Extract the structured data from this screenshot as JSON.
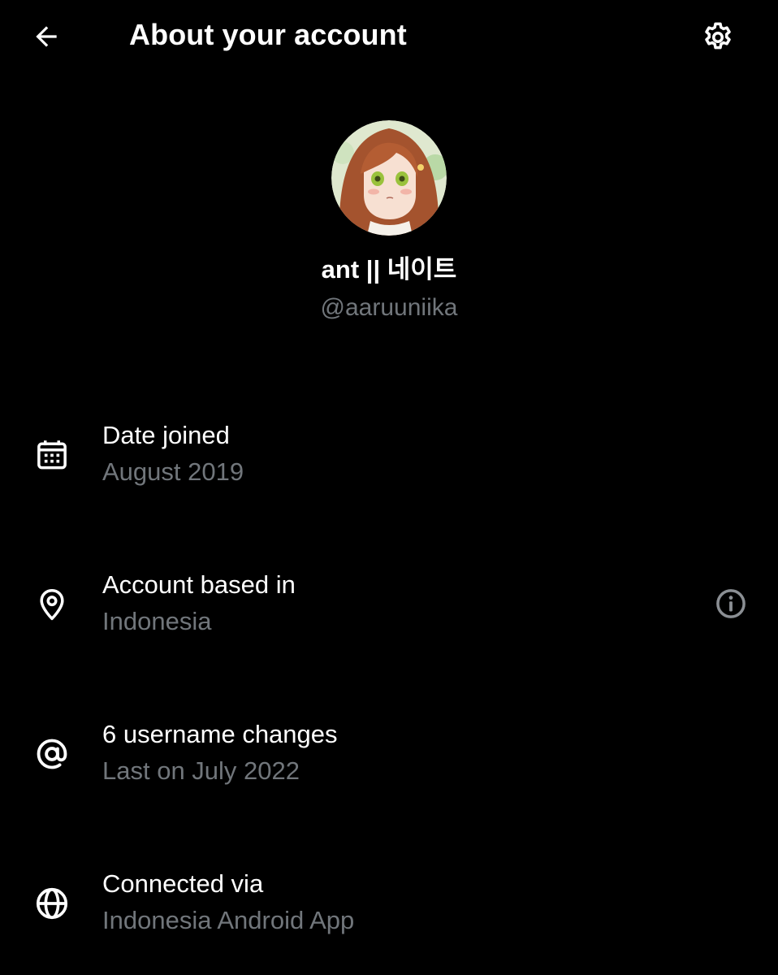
{
  "header": {
    "title": "About your account",
    "back_icon": "arrow-left-icon",
    "settings_icon": "gear-icon"
  },
  "profile": {
    "display_name": "ant || 네이트",
    "handle": "@aaruuniika"
  },
  "rows": [
    {
      "icon": "calendar-icon",
      "label": "Date joined",
      "value": "August 2019"
    },
    {
      "icon": "location-pin-icon",
      "label": "Account based in",
      "value": "Indonesia",
      "trailing_icon": "info-icon"
    },
    {
      "icon": "at-sign-icon",
      "label": "6 username changes",
      "value": "Last on July 2022"
    },
    {
      "icon": "globe-icon",
      "label": "Connected via",
      "value": "Indonesia Android App"
    }
  ],
  "colors": {
    "background": "#000000",
    "primary_text": "#ffffff",
    "secondary_text": "#71767b",
    "info_icon": "#8b8f94"
  }
}
